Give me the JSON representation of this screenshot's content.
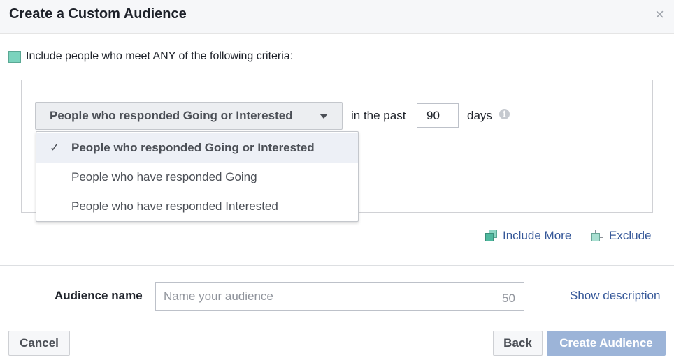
{
  "dialog": {
    "title": "Create a Custom Audience",
    "close_symbol": "×"
  },
  "criteria": {
    "text": "Include people who meet ANY of the following criteria:",
    "swatch_color": "#7bd3bd"
  },
  "rule": {
    "selected_option": "People who responded Going or Interested",
    "in_the_past": "in the past",
    "days_value": "90",
    "days_label": "days",
    "info_icon": "info-icon",
    "options": [
      {
        "label": "People who responded Going or Interested",
        "selected": true
      },
      {
        "label": "People who have responded Going",
        "selected": false
      },
      {
        "label": "People who have responded Interested",
        "selected": false
      }
    ],
    "check_symbol": "✓"
  },
  "links": {
    "include_more": "Include More",
    "exclude": "Exclude"
  },
  "audience": {
    "label": "Audience name",
    "placeholder": "Name your audience",
    "char_count": "50",
    "show_description": "Show description"
  },
  "footer": {
    "cancel": "Cancel",
    "back": "Back",
    "create": "Create Audience"
  },
  "colors": {
    "link": "#365899",
    "primary_disabled": "#9cb4d8"
  }
}
